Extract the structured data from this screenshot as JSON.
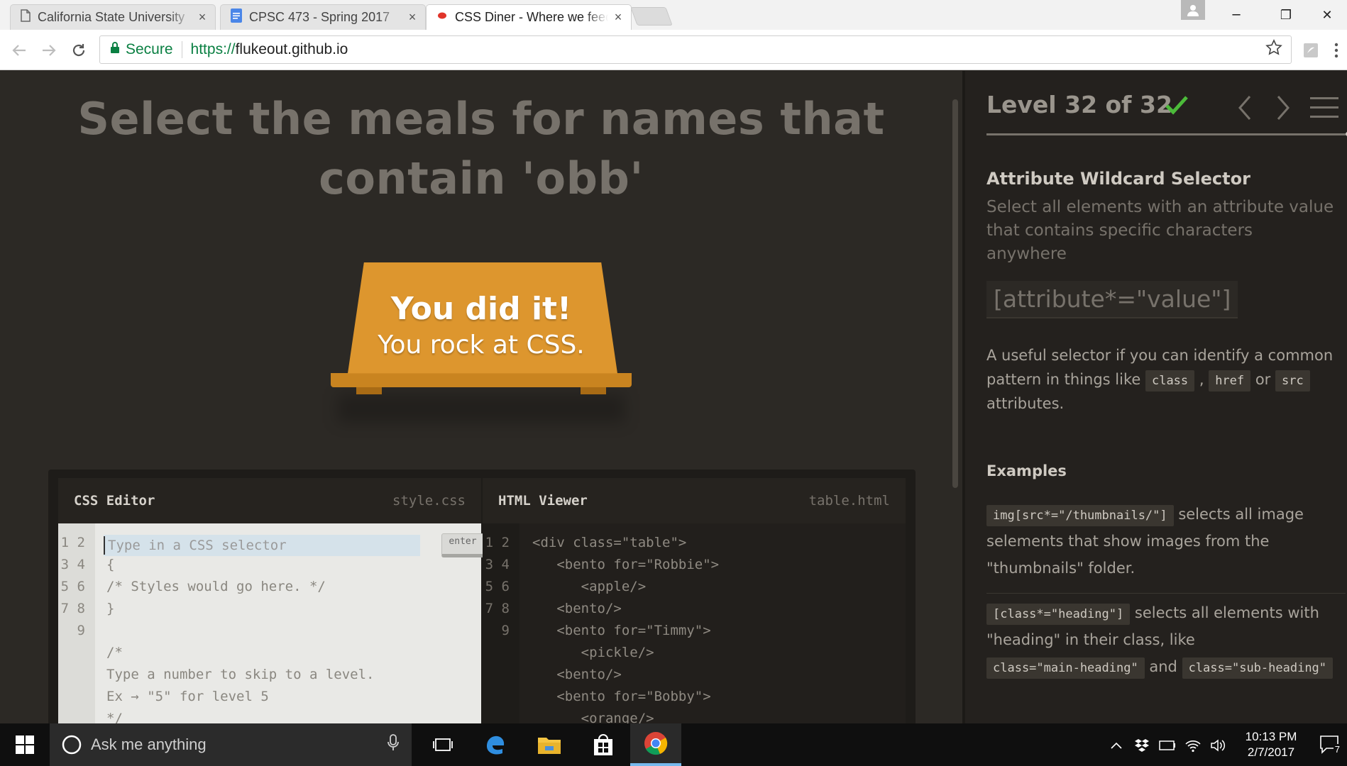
{
  "browser": {
    "tabs": [
      {
        "label": "California State University",
        "close": "×"
      },
      {
        "label": "CPSC 473 - Spring 2017",
        "close": "×"
      },
      {
        "label": "CSS Diner - Where we feed on CSS",
        "close": "×"
      }
    ],
    "window": {
      "minimize": "─",
      "restore": "❐",
      "close": "✕"
    },
    "omnibox": {
      "secure_label": "Secure",
      "url_scheme": "https://",
      "url_host": "flukeout.github.io"
    }
  },
  "game": {
    "order": "Select the meals for names that contain 'obb'",
    "table_message": {
      "line1": "You did it!",
      "line2": "You rock at CSS."
    },
    "css_editor": {
      "title": "CSS Editor",
      "filename": "style.css",
      "input_placeholder": "Type in a CSS selector",
      "input_value": "",
      "enter_label": "enter",
      "line_numbers": "1\n2\n3\n4\n5\n6\n7\n8\n9",
      "code": "\n{\n/* Styles would go here. */\n}\n\n/*\nType a number to skip to a level.\nEx → \"5\" for level 5\n*/"
    },
    "html_viewer": {
      "title": "HTML Viewer",
      "filename": "table.html",
      "line_numbers": "1\n2\n3\n4\n5\n6\n7\n8\n9",
      "code": "<div class=\"table\">\n   <bento for=\"Robbie\">\n      <apple/>\n   <bento/>\n   <bento for=\"Timmy\">\n      <pickle/>\n   <bento/>\n   <bento for=\"Bobby\">\n      <orange/>"
    }
  },
  "sidebar": {
    "level_title": "Level 32 of 32",
    "level_completed": true,
    "level_progress": 1.0,
    "selector_name": "Attribute Wildcard Selector",
    "selector_title": "Select all elements with an attribute value that contains specific characters anywhere",
    "syntax": "[attribute*=\"value\"]",
    "hint": {
      "part1": "A useful selector if you can identify a common pattern in things like ",
      "chip1": "class",
      "sep1": " , ",
      "chip2": "href",
      "sep2": " or ",
      "chip3": "src",
      "part2": " attributes."
    },
    "examples_title": "Examples",
    "examples": [
      {
        "code": "img[src*=\"/thumbnails/\"]",
        "text": " selects all image selements that show images from the \"thumbnails\" folder."
      },
      {
        "code": "[class*=\"heading\"]",
        "text1": " selects all elements with \"heading\" in their class, like ",
        "code2": "class=\"main-heading\"",
        "and": " and ",
        "code3": "class=\"sub-heading\""
      }
    ]
  },
  "taskbar": {
    "search_placeholder": "Ask me anything",
    "clock_time": "10:13 PM",
    "clock_date": "2/7/2017",
    "notification_count": "7"
  },
  "colors": {
    "accent_green": "#4cbb3a",
    "table_orange": "#dd962e",
    "secure_green": "#0b8043"
  }
}
